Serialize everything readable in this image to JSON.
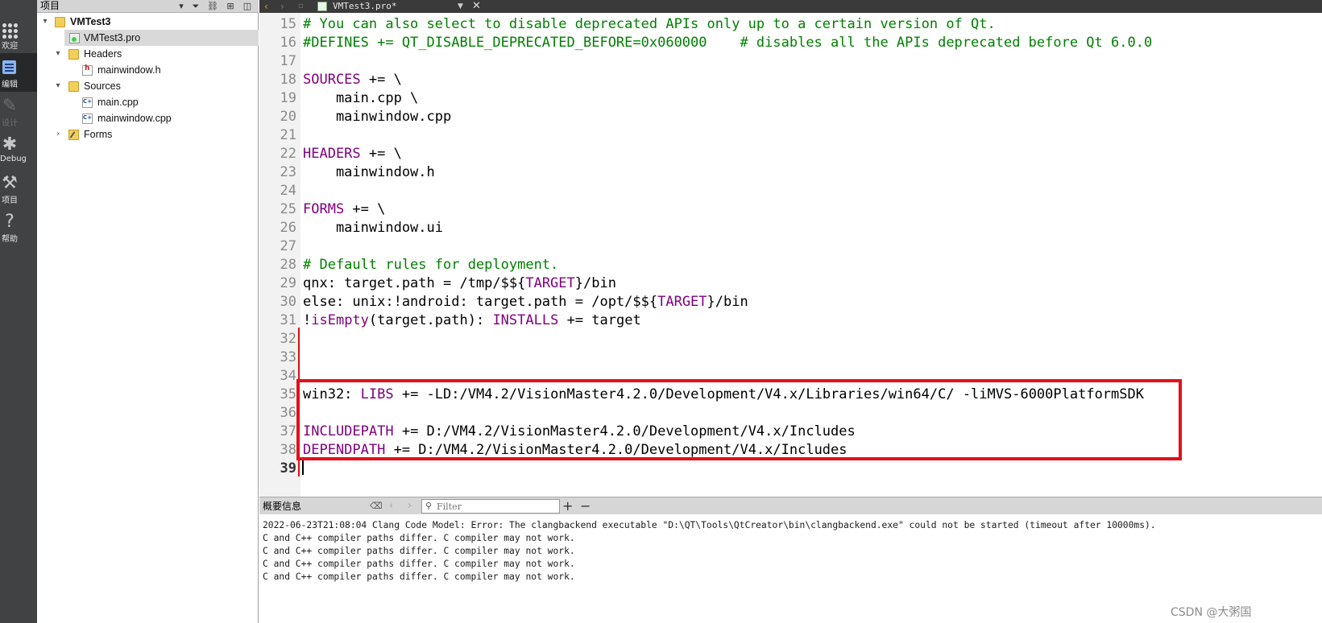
{
  "modes": [
    {
      "label": "欢迎",
      "icon": "grid-icon",
      "active": false
    },
    {
      "label": "编辑",
      "icon": "edit-icon",
      "active": true
    },
    {
      "label": "设计",
      "icon": "pen-icon",
      "active": false,
      "disabled": true
    },
    {
      "label": "Debug",
      "icon": "bug-icon",
      "active": false
    },
    {
      "label": "项目",
      "icon": "wrench-icon",
      "active": false
    },
    {
      "label": "帮助",
      "icon": "help-icon",
      "active": false
    }
  ],
  "project_panel": {
    "title": "项目",
    "tree": [
      {
        "label": "VMTest3",
        "bold": true,
        "expanded": true
      },
      {
        "label": "VMTest3.pro",
        "selected": true
      },
      {
        "label": "Headers",
        "expanded": true
      },
      {
        "label": "mainwindow.h"
      },
      {
        "label": "Sources",
        "expanded": true
      },
      {
        "label": "main.cpp"
      },
      {
        "label": "mainwindow.cpp"
      },
      {
        "label": "Forms",
        "expanded": false
      }
    ]
  },
  "editor": {
    "tab_file": "VMTest3.pro*",
    "lines": [
      {
        "n": "15",
        "t": "# You can also select to disable deprecated APIs only up to a certain version of Qt."
      },
      {
        "n": "16",
        "t": "#DEFINES += QT_DISABLE_DEPRECATED_BEFORE=0x060000    # disables all the APIs deprecated before Qt 6.0.0"
      },
      {
        "n": "17",
        "t": ""
      },
      {
        "n": "18",
        "v": "SOURCES",
        "t": " += \\"
      },
      {
        "n": "19",
        "t": "    main.cpp \\"
      },
      {
        "n": "20",
        "t": "    mainwindow.cpp"
      },
      {
        "n": "21",
        "t": ""
      },
      {
        "n": "22",
        "v": "HEADERS",
        "t": " += \\"
      },
      {
        "n": "23",
        "t": "    mainwindow.h"
      },
      {
        "n": "24",
        "t": ""
      },
      {
        "n": "25",
        "v": "FORMS",
        "t": " += \\"
      },
      {
        "n": "26",
        "t": "    mainwindow.ui"
      },
      {
        "n": "27",
        "t": ""
      },
      {
        "n": "28",
        "t": "# Default rules for deployment."
      },
      {
        "n": "29",
        "a": "qnx: target.path = /tmp/$${",
        "v": "TARGET",
        "t": "}/bin"
      },
      {
        "n": "30",
        "a": "else: unix:!android: target.path = /opt/$${",
        "v": "TARGET",
        "t": "}/bin"
      },
      {
        "n": "31",
        "a": "!",
        "f": "isEmpty",
        "b": "(target.path): ",
        "v": "INSTALLS",
        "t": " += target"
      },
      {
        "n": "32",
        "t": ""
      },
      {
        "n": "33",
        "t": ""
      },
      {
        "n": "34",
        "t": ""
      },
      {
        "n": "35",
        "a": "win32: ",
        "v": "LIBS",
        "t": " += -LD:/VM4.2/VisionMaster4.2.0/Development/V4.x/Libraries/win64/C/ -liMVS-6000PlatformSDK"
      },
      {
        "n": "36",
        "t": ""
      },
      {
        "n": "37",
        "v": "INCLUDEPATH",
        "t": " += D:/VM4.2/VisionMaster4.2.0/Development/V4.x/Includes"
      },
      {
        "n": "38",
        "v": "DEPENDPATH",
        "t": " += D:/VM4.2/VisionMaster4.2.0/Development/V4.x/Includes"
      },
      {
        "n": "39",
        "t": ""
      }
    ]
  },
  "output": {
    "title": "概要信息",
    "filter_placeholder": "Filter",
    "lines": [
      "2022-06-23T21:08:04 Clang Code Model: Error: The clangbackend executable \"D:\\QT\\Tools\\QtCreator\\bin\\clangbackend.exe\" could not be started (timeout after 10000ms).",
      "C and C++ compiler paths differ. C compiler may not work.",
      "C and C++ compiler paths differ. C compiler may not work.",
      "C and C++ compiler paths differ. C compiler may not work.",
      "C and C++ compiler paths differ. C compiler may not work."
    ]
  },
  "watermark": "CSDN @大粥国",
  "colors": {
    "comment": "#008000",
    "keyword_var": "#800080",
    "highlight_box": "#e3101a",
    "modebar": "#404244"
  }
}
